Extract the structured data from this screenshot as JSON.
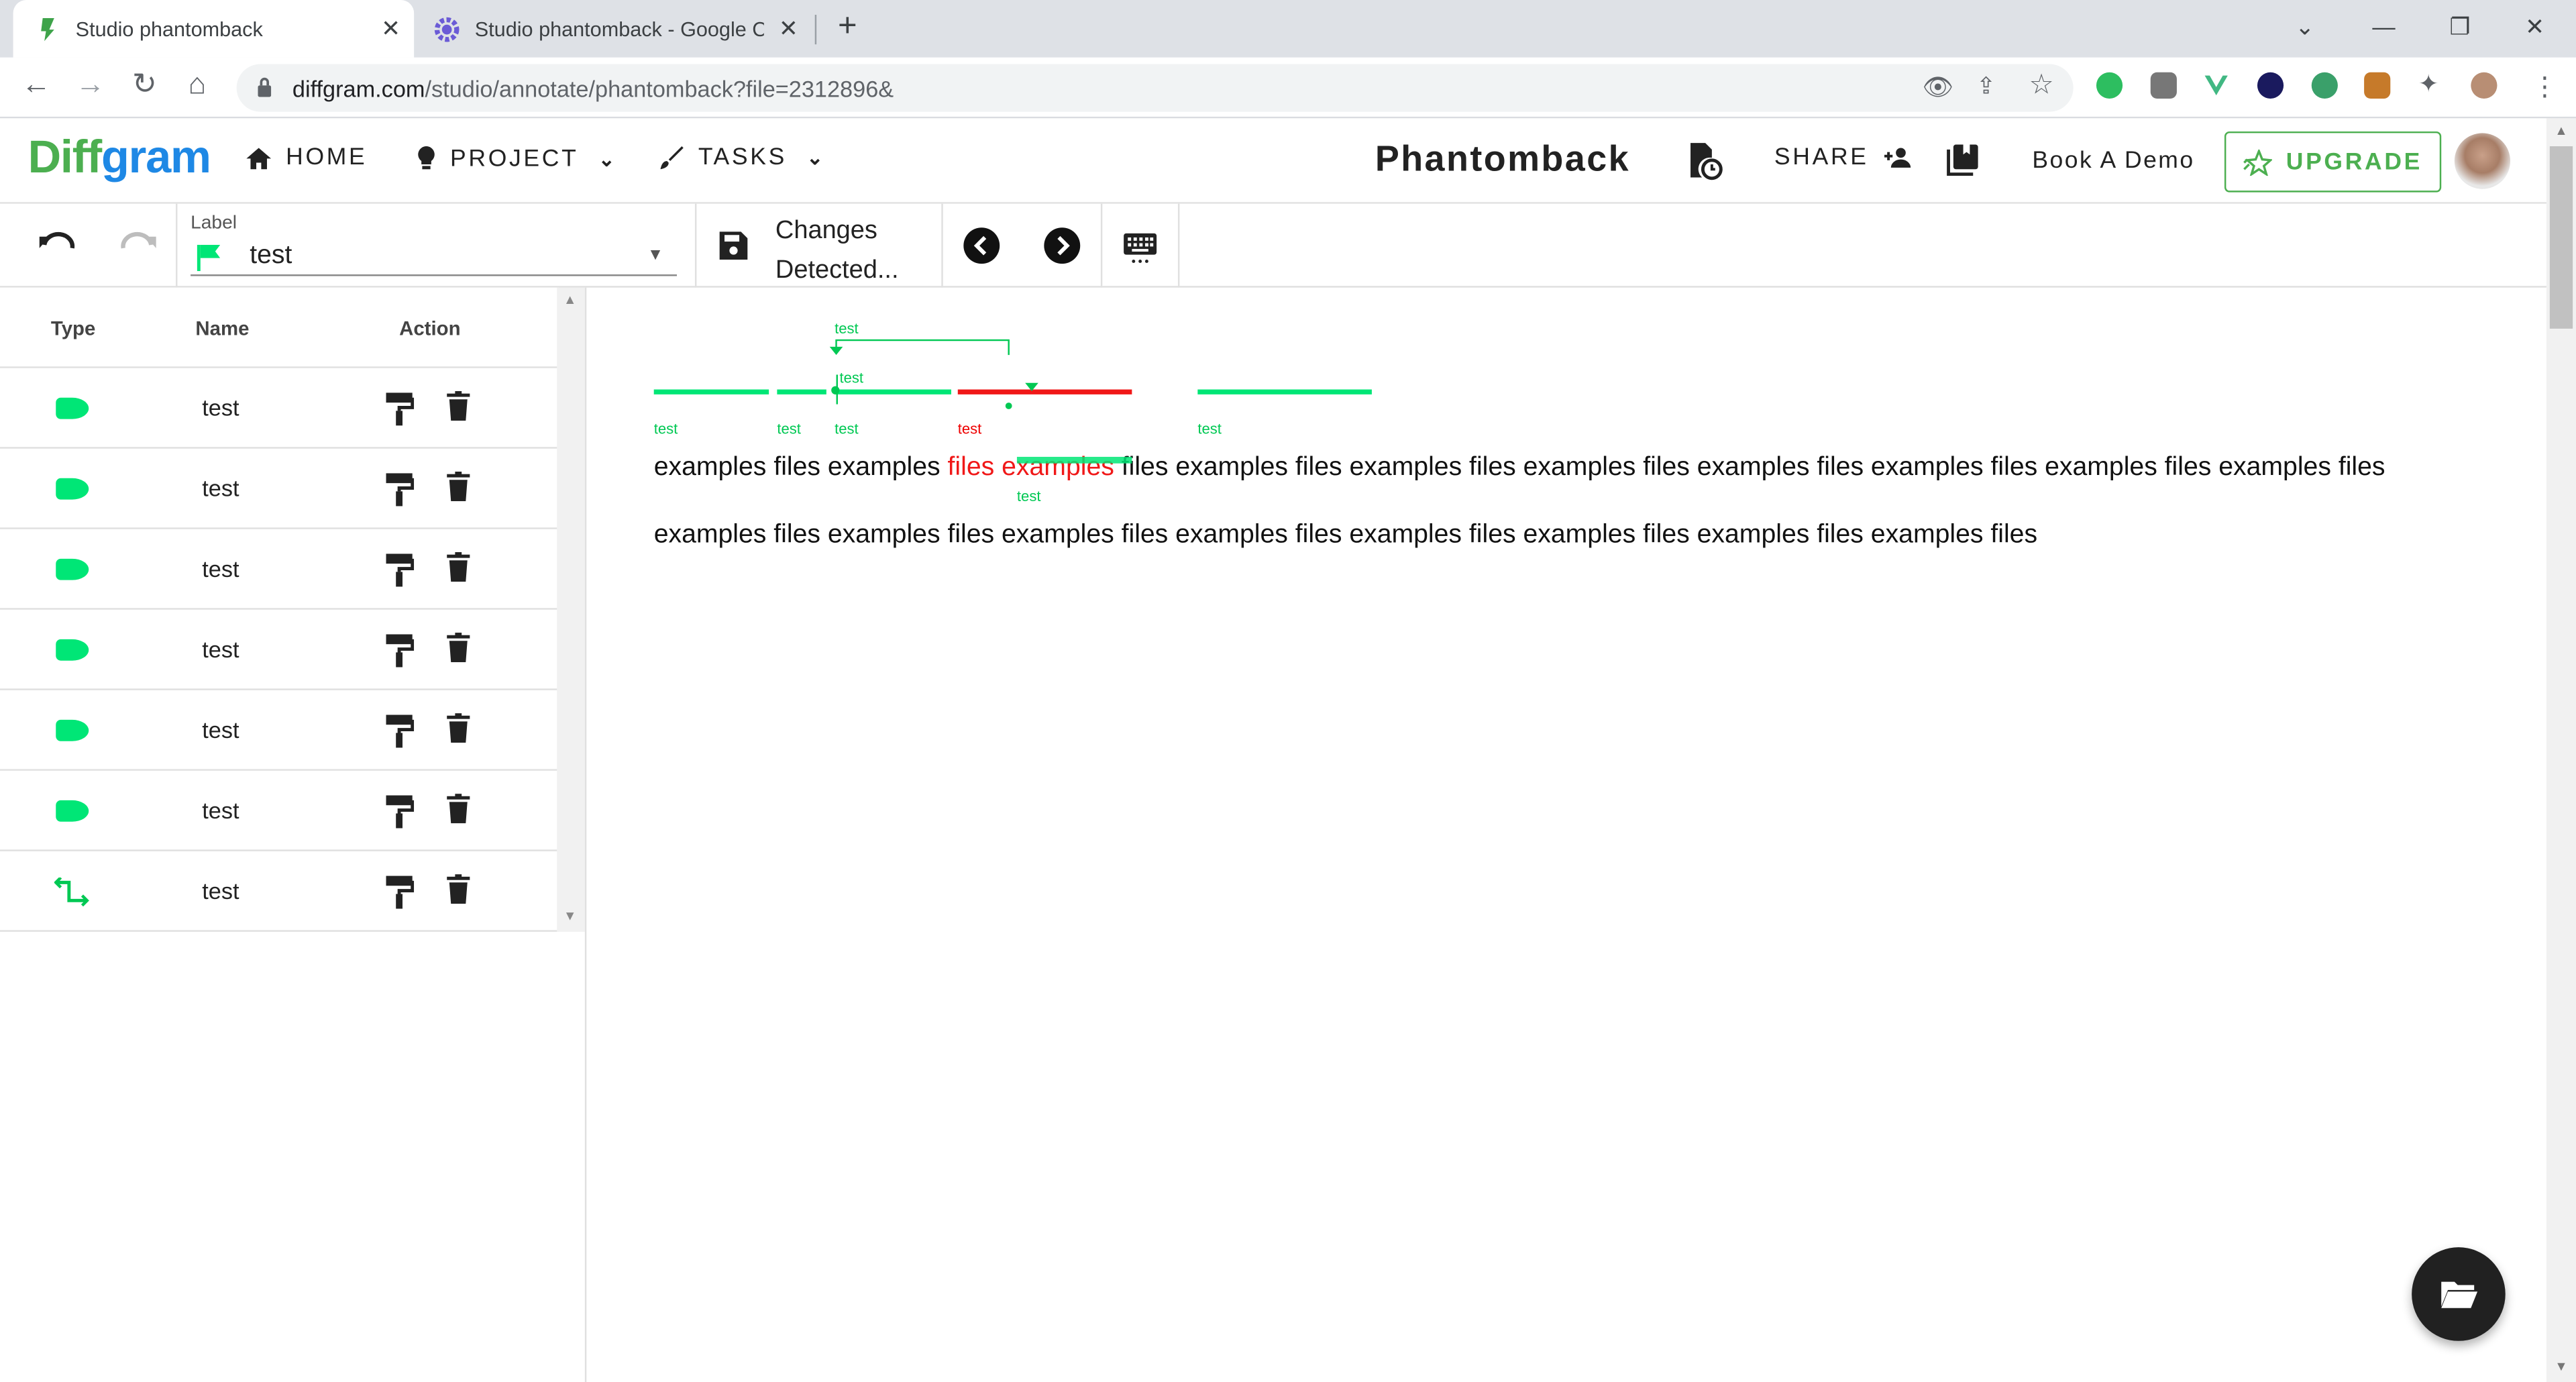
{
  "browser": {
    "tabs": [
      {
        "title": "Studio phantomback",
        "active": true
      },
      {
        "title": "Studio phantomback - Google Cl",
        "active": false
      }
    ],
    "url_host": "diffgram.com",
    "url_path": "/studio/annotate/phantomback?file=2312896&"
  },
  "app": {
    "logo_part1": "Diff",
    "logo_part2": "gram",
    "nav": {
      "home": "HOME",
      "project": "PROJECT",
      "tasks": "TASKS"
    },
    "project_title": "Phantomback",
    "share_label": "SHARE",
    "book_demo_label": "Book A Demo",
    "upgrade_label": "UPGRADE",
    "colors": {
      "accent_green": "#4caf50",
      "label_green": "#00e676",
      "error_red": "#f01818"
    }
  },
  "toolbar": {
    "label_caption": "Label",
    "label_value": "test",
    "save_status_line1": "Changes",
    "save_status_line2": "Detected..."
  },
  "panel": {
    "headers": {
      "type": "Type",
      "name": "Name",
      "action": "Action"
    },
    "rows": [
      {
        "type": "tag-icon",
        "name": "test"
      },
      {
        "type": "tag-icon",
        "name": "test"
      },
      {
        "type": "tag-icon",
        "name": "test"
      },
      {
        "type": "tag-icon",
        "name": "test"
      },
      {
        "type": "tag-icon",
        "name": "test"
      },
      {
        "type": "tag-icon",
        "name": "test"
      },
      {
        "type": "relation-icon",
        "name": "test"
      }
    ]
  },
  "canvas": {
    "span_labels": {
      "a": "test",
      "b": "test",
      "c": "test",
      "d": "test",
      "e": "test",
      "f": "test",
      "rel": "test",
      "rel2": "test"
    },
    "line1": {
      "w1": "examples",
      "w2": "files",
      "w3": "examples",
      "w4_red": "files",
      "w5_red": "examples",
      "rest": "files examples files examples files examples files examples files examples files examples files examples files"
    },
    "line2": "examples files examples files examples files examples files examples files examples files examples files examples files"
  }
}
